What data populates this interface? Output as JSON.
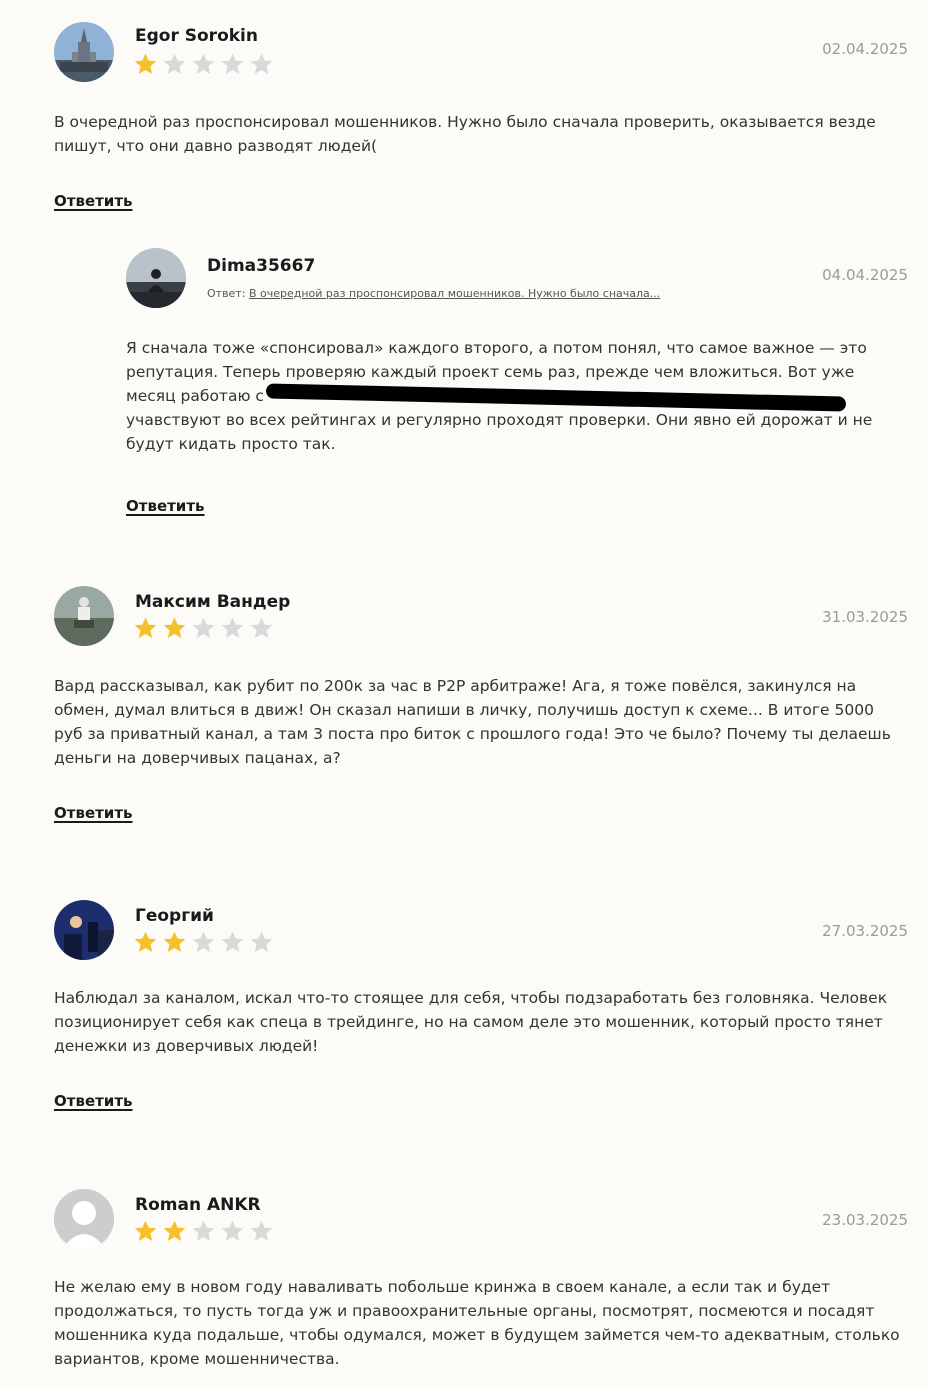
{
  "answer_label": "Ответить",
  "star_color_on": "#f5c02a",
  "star_color_off": "#d9d9d9",
  "reviews": [
    {
      "author": "Egor Sorokin",
      "date": "02.04.2025",
      "rating": 1,
      "text": "В очередной раз проспонсировал мошенников. Нужно было сначала проверить, оказывается везде пишут, что они давно разводят людей(",
      "avatar_icon": "building-photo"
    },
    {
      "author": "Dima35667",
      "date": "04.04.2025",
      "reply_prefix": "Ответ:",
      "reply_quote": "В очередной раз проспонсировал мошенников. Нужно было сначала...",
      "text_line1": "Я сначала тоже «спонсировал» каждого второго, а потом понял, что самое важное — это",
      "text_line2": "репутация. Теперь проверяю каждый проект семь раз, прежде чем вложиться. Вот уже",
      "text_line3": "месяц работаю с",
      "text_line4": "учавствуют во всех рейтингах и регулярно проходят проверки. Они явно ей дорожат и не",
      "text_line5": "будут кидать просто так.",
      "avatar_icon": "person-sitting-photo"
    },
    {
      "author": "Максим Вандер",
      "date": "31.03.2025",
      "rating": 2,
      "text": "Вард рассказывал, как рубит по 200к за час в P2P арбитраже! Ага, я тоже повёлся, закинулся на обмен, думал влиться в движ! Он сказал напиши в личку, получишь доступ к схеме... В итоге 5000 руб за приватный канал, а там 3 поста про биток с прошлого года! Это че было? Почему ты делаешь деньги на доверчивых пацанах, а?",
      "avatar_icon": "person-outdoor-photo"
    },
    {
      "author": "Георгий",
      "date": "27.03.2025",
      "rating": 2,
      "text": "Наблюдал за каналом, искал что-то стоящее для себя, чтобы подзаработать без головняка. Человек позиционирует себя как спеца в трейдинге, но на самом деле это мошенник, который просто тянет денежки из доверчивых людей!",
      "avatar_icon": "night-city-photo"
    },
    {
      "author": "Roman ANKR",
      "date": "23.03.2025",
      "rating": 2,
      "text": "Не желаю ему в новом году наваливать побольше кринжа в своем канале, а если так и будет продолжаться, то пусть тогда уж и правоохранительные органы, посмотрят, посмеются и посадят мошенника куда подальше, чтобы одумался, может в будущем займется чем-то адекватным, столько вариантов, кроме мошенничества.",
      "avatar_icon": "default-user-icon"
    }
  ]
}
